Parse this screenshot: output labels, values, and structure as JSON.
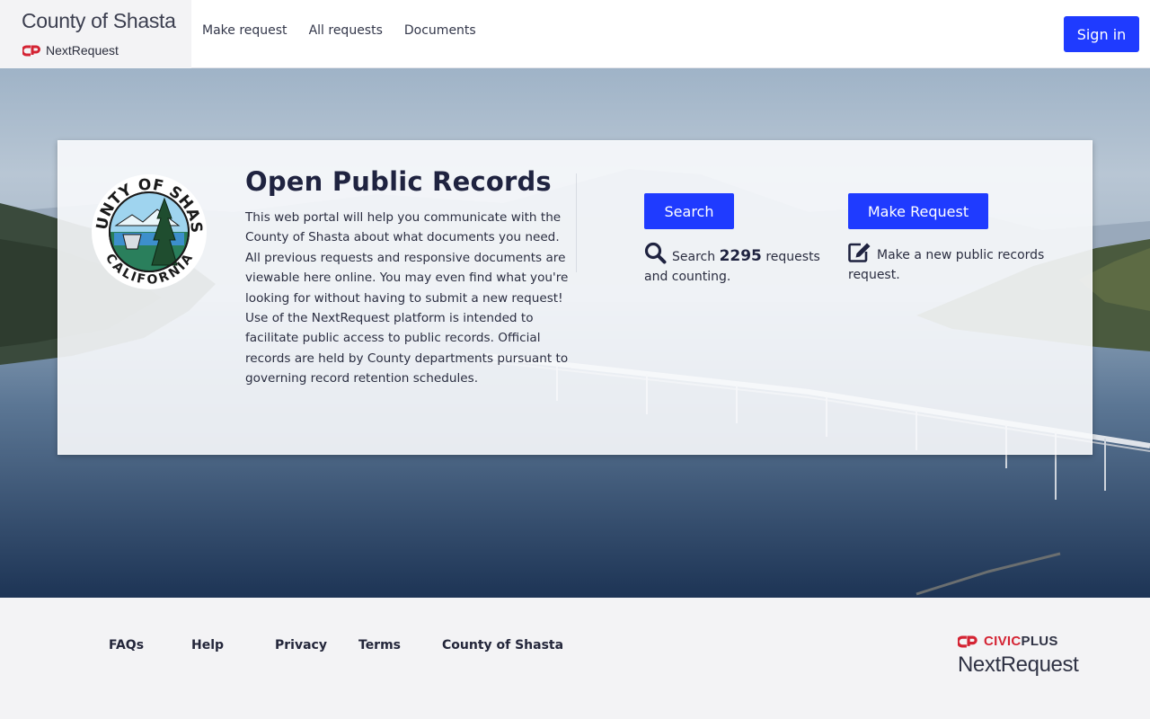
{
  "header": {
    "brand_title": "County of Shasta",
    "brand_sub": "NextRequest",
    "nav": [
      "Make request",
      "All requests",
      "Documents"
    ],
    "signin_label": "Sign in"
  },
  "hero": {
    "title": "Open Public Records",
    "intro": "This web portal will help you communicate with the County of Shasta about what documents you need. All previous requests and responsive documents are viewable here online. You may even find what you're looking for without having to submit a new request! Use of the NextRequest platform is intended to facilitate public access to public records. Official records are held by County departments pursuant to governing record retention schedules.",
    "seal": {
      "top_text": "COUNTY OF SHASTA",
      "bottom_text": "CALIFORNIA"
    },
    "search": {
      "button_label": "Search",
      "desc_prefix": "Search",
      "count": "2295",
      "desc_suffix": "requests and counting.",
      "icon": "search-icon"
    },
    "make": {
      "button_label": "Make Request",
      "desc": "Make a new public records request.",
      "icon": "edit-icon"
    }
  },
  "footer": {
    "links": [
      "FAQs",
      "Help",
      "Privacy",
      "Terms",
      "County of Shasta"
    ],
    "civic_a": "CIVIC",
    "civic_b": "PLUS",
    "civic_product": "NextRequest"
  },
  "colors": {
    "primary": "#1f3bff",
    "civic_red": "#d42333",
    "heading": "#1f2340"
  }
}
